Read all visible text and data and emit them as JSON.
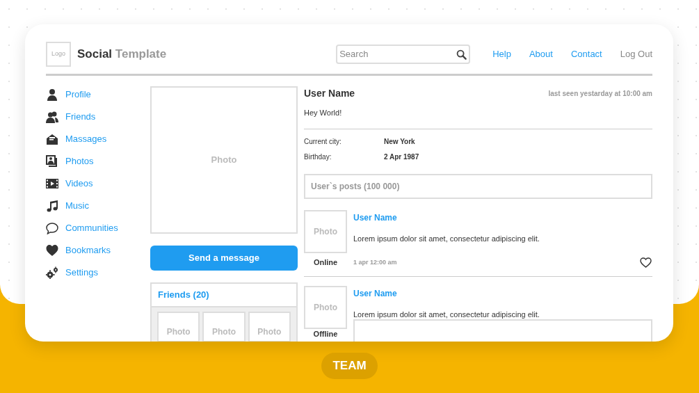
{
  "header": {
    "logo": "Logo",
    "title_bold": "Social",
    "title_light": "Template",
    "search": {
      "placeholder": "Search"
    },
    "links": [
      {
        "label": "Help",
        "kind": "link"
      },
      {
        "label": "About",
        "kind": "link"
      },
      {
        "label": "Contact",
        "kind": "link"
      },
      {
        "label": "Log Out",
        "kind": "muted"
      }
    ]
  },
  "sidebar": {
    "items": [
      {
        "label": "Profile"
      },
      {
        "label": "Friends"
      },
      {
        "label": "Massages"
      },
      {
        "label": "Photos"
      },
      {
        "label": "Videos"
      },
      {
        "label": "Music"
      },
      {
        "label": "Communities"
      },
      {
        "label": "Bookmarks"
      },
      {
        "label": "Settings"
      }
    ]
  },
  "profile": {
    "photo": "Photo",
    "button": "Send a message",
    "friends": {
      "title": "Friends (20)",
      "photos": [
        "Photo",
        "Photo",
        "Photo"
      ]
    }
  },
  "user": {
    "name": "User Name",
    "last_seen": "last seen yestarday at 10:00 am",
    "status": "Hey World!",
    "fields": [
      {
        "label": "Current city:",
        "value": "New York"
      },
      {
        "label": "Birthday:",
        "value": "2 Apr 1987"
      }
    ]
  },
  "posts": {
    "title": "User`s posts (100 000)",
    "items": [
      {
        "kind": "footer",
        "photo": "Photo",
        "author": "User Name",
        "text": "Lorem ipsum dolor sit amet, consectetur adipiscing elit.",
        "presence": "Online",
        "time": "1 apr 12:00 am"
      },
      {
        "kind": "attachment",
        "photo": "Photo",
        "author": "User Name",
        "text": "Lorem ipsum dolor sit amet, consectetur adipiscing elit.",
        "presence": "Offline"
      }
    ]
  },
  "badge": "TEAM"
}
